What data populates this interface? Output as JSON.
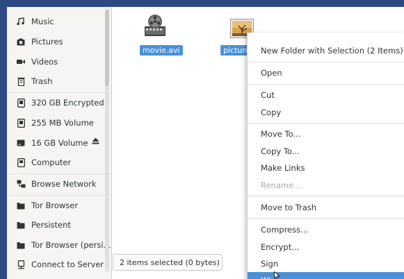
{
  "sidebar": {
    "items": [
      {
        "label": "Music",
        "icon": "music-note-icon"
      },
      {
        "label": "Pictures",
        "icon": "camera-icon"
      },
      {
        "label": "Videos",
        "icon": "film-icon"
      },
      {
        "label": "Trash",
        "icon": "trash-icon"
      },
      {
        "label": "320 GB Encrypted",
        "icon": "drive-icon"
      },
      {
        "label": "255 MB Volume",
        "icon": "drive-icon"
      },
      {
        "label": "16 GB Volume",
        "icon": "drive-icon"
      },
      {
        "label": "Computer",
        "icon": "computer-icon"
      },
      {
        "label": "Browse Network",
        "icon": "network-icon"
      },
      {
        "label": "Tor Browser",
        "icon": "folder-icon"
      },
      {
        "label": "Persistent",
        "icon": "folder-icon"
      },
      {
        "label": "Tor Browser (persi...",
        "icon": "folder-icon"
      },
      {
        "label": "Connect to Server",
        "icon": "server-icon"
      }
    ],
    "eject_icon": "eject-icon"
  },
  "files": [
    {
      "label": "movie.avi",
      "icon": "video-file-icon",
      "selected": true
    },
    {
      "label": "picture",
      "icon": "image-file-icon",
      "selected": true
    }
  ],
  "status": {
    "text": "2 items selected (0 bytes)"
  },
  "context_menu": {
    "items": [
      {
        "label": "New Folder with Selection (2 Items)"
      },
      {
        "label": "Open"
      },
      {
        "label": "Cut"
      },
      {
        "label": "Copy"
      },
      {
        "label": "Move To..."
      },
      {
        "label": "Copy To..."
      },
      {
        "label": "Make Links"
      },
      {
        "label": "Rename...",
        "disabled": true
      },
      {
        "label": "Move to Trash"
      },
      {
        "label": "Compress..."
      },
      {
        "label": "Encrypt..."
      },
      {
        "label": "Sign"
      },
      {
        "label": "Wipe",
        "highlighted": true
      }
    ]
  },
  "colors": {
    "selection": "#4a90d9",
    "desktop": "#2c4a82"
  }
}
